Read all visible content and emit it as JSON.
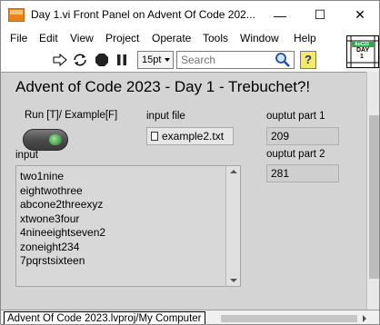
{
  "window": {
    "title": "Day 1.vi Front Panel on Advent Of Code 202...",
    "minimize_glyph": "—",
    "maximize_glyph": "☐",
    "close_glyph": "✕"
  },
  "menu": {
    "items": [
      "File",
      "Edit",
      "View",
      "Project",
      "Operate",
      "Tools",
      "Window",
      "Help"
    ]
  },
  "toolbar": {
    "font_size": "15pt",
    "search_placeholder": "Search",
    "help_label": "?",
    "icons": [
      "run-arrow-icon",
      "run-continuously-icon",
      "abort-icon",
      "pause-icon",
      "search-icon",
      "help-icon"
    ]
  },
  "vi_icon": {
    "line1": "AoC23",
    "line2": "DAY",
    "line3": "1"
  },
  "panel": {
    "title": "Advent of Code 2023 - Day 1 - Trebuchet?!",
    "run_toggle_label": "Run [T]/ Example[F]",
    "input_file_label": "input file",
    "input_file_value": "example2.txt",
    "output1_label": "ouptut part 1",
    "output1_value": "209",
    "output2_label": "ouptut part 2",
    "output2_value": "281",
    "input_label": "input",
    "input_lines": [
      "two1nine",
      "eightwothree",
      "abcone2threexyz",
      "xtwone3four",
      "4nineeightseven2",
      "zoneight234",
      "7pqrstsixteen"
    ]
  },
  "status": {
    "project_path": "Advent Of Code 2023.lvproj/My Computer"
  },
  "colors": {
    "panel_bg": "#d4d4d4",
    "led_green": "#1f7a1f",
    "help_yellow": "#f5e96a",
    "titlebar_icon_orange": "#e8821a"
  }
}
